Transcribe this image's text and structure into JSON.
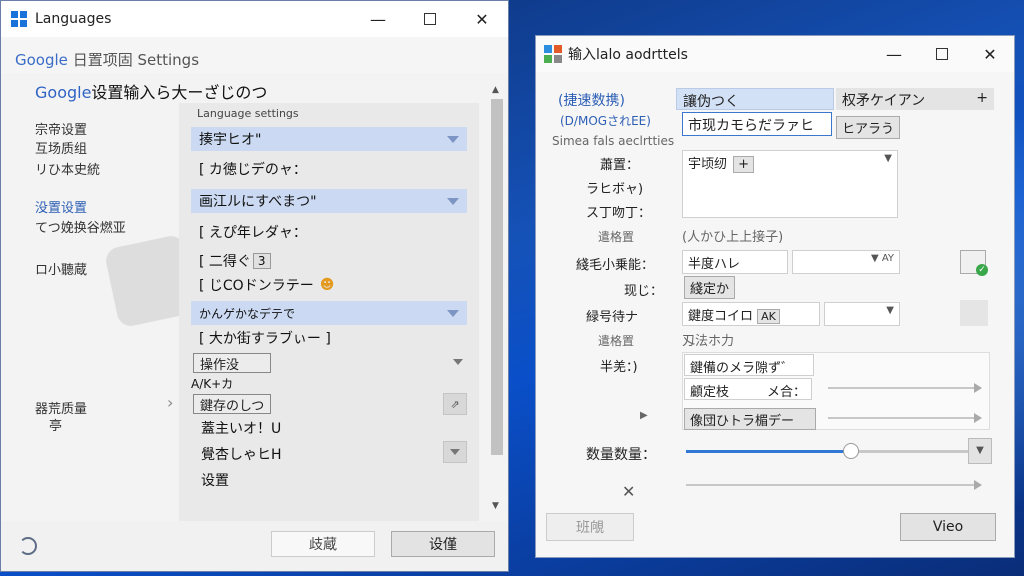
{
  "window1": {
    "title": "Languages",
    "header": {
      "google": "Google",
      "label": "日置项固",
      "settings": "Settings"
    },
    "heading": {
      "google": "Google",
      "rest": "设置输入ら大ーざじのつ"
    },
    "nav": [
      "宗帝设置",
      "互场质组",
      "リひ本史統",
      "没置设置",
      "てつ娩换谷燃亚",
      "ロ小聽蔵",
      "器荒质量",
      "亭"
    ],
    "panel_caption": "Language settings",
    "rows": [
      {
        "text": "揍宇ヒオ\"",
        "selected": true
      },
      {
        "text": "[ カ徳じデのャ：",
        "selected": false
      },
      {
        "text": "画江ルにすべまつ\"",
        "selected": true
      },
      {
        "text": "[ えぴ年レダャ：",
        "selected": false
      },
      {
        "text": "[ 二得ぐ",
        "box": "3",
        "selected": false
      },
      {
        "text": "[ じCOドンラテー",
        "selected": false
      },
      {
        "text": "かんゲかなデテで",
        "selected": true
      },
      {
        "text": "[ 大か街すラブぃー ]",
        "selected": false
      }
    ],
    "dropdown_label": "操作没",
    "sub_label": "A/K+カ",
    "button_label": "鍵存のしつ",
    "list2": [
      "蓋主いオ！U",
      "覺杏しゃヒH",
      "设置"
    ],
    "footer": {
      "cancel": "歧蔵",
      "ok": "设僅"
    }
  },
  "window2": {
    "title": "输入lalo aodrttels",
    "left_title": "(捷速数携)",
    "left_sub": "(D/MOGされEE)",
    "left_caption": "Simea fals aeclrtties",
    "tab1": "讓伪つく",
    "tab2": "权矛ケイアン",
    "tab2_icon": "+",
    "active_field": "市现カモらだラァヒ",
    "side_chip": "ヒアラう",
    "rows": [
      {
        "label": "蕭置：",
        "value": "宇顷纫"
      },
      {
        "label": "ラヒボャ)",
        "value": ""
      },
      {
        "label": "ス丁吻丁：",
        "value": ""
      }
    ],
    "gray_label_1": "遣格置",
    "gray_value_1": "(人かひ上上接子)",
    "field_label_1": "綫毛小乗能：",
    "field_value_1": "半度ハレ",
    "field_dropdown_1": "AY",
    "chip_label_1": "现じ：",
    "chip_value_1": "綫定か",
    "field_label_2": "緑号待ナ",
    "field_value_2": "鍵度コイロ",
    "field_chip_2": "AK",
    "gray_label_2": "遣格置",
    "gray_value_2": "刄法ホ力",
    "list_label": "半羌：)",
    "list_items": [
      "鍵備のメラ隙ず゛",
      "顧定枝",
      "像団ひトラ楣デー"
    ],
    "list_item_suffix": "メ合：",
    "slider_label": "数量数量：",
    "slider_value": 0.57,
    "footer_left": "班䚁",
    "footer_right": "Vieo"
  },
  "colors": {
    "accent": "#2d5fb5",
    "selection": "#cbdaf2",
    "slider": "#2f78d6"
  }
}
